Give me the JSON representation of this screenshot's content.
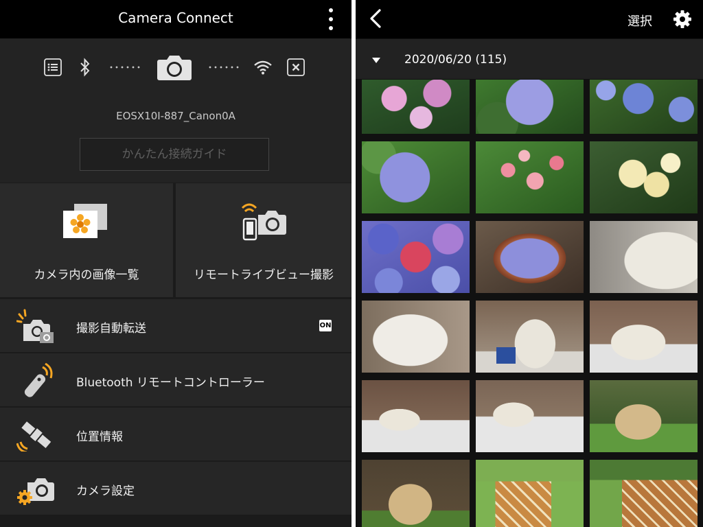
{
  "left": {
    "header": {
      "title": "Camera Connect"
    },
    "connection": {
      "camera_name": "EOSX10I-887_Canon0A",
      "guide_label": "かんたん接続ガイド"
    },
    "tiles": [
      {
        "label": "カメラ内の画像一覧",
        "icon": "image-list-icon"
      },
      {
        "label": "リモートライブビュー撮影",
        "icon": "remote-shoot-icon"
      }
    ],
    "menu": [
      {
        "label": "撮影自動転送",
        "icon": "auto-transfer-icon",
        "badge": "ON"
      },
      {
        "label": "Bluetooth リモートコントローラー",
        "icon": "bluetooth-remote-icon"
      },
      {
        "label": "位置情報",
        "icon": "satellite-icon"
      },
      {
        "label": "カメラ設定",
        "icon": "camera-settings-icon"
      }
    ]
  },
  "right": {
    "header": {
      "select_label": "選択"
    },
    "date_group": {
      "label": "2020/06/20 (115)"
    },
    "thumbnails": [
      "hydrangea-pink",
      "hydrangea-blue",
      "hydrangea-blue2",
      "hydrangea-lav",
      "roses-pink",
      "roses-cream",
      "hydrangea-mix",
      "bowl",
      "bear1",
      "bear2",
      "bear3",
      "bear4",
      "bear5",
      "bear6",
      "lion1",
      "lion2",
      "giraffe1",
      "giraffe2"
    ]
  },
  "colors": {
    "accent_orange": "#f5a623",
    "bg_dark": "#1b1b1b",
    "header_black": "#000000"
  }
}
